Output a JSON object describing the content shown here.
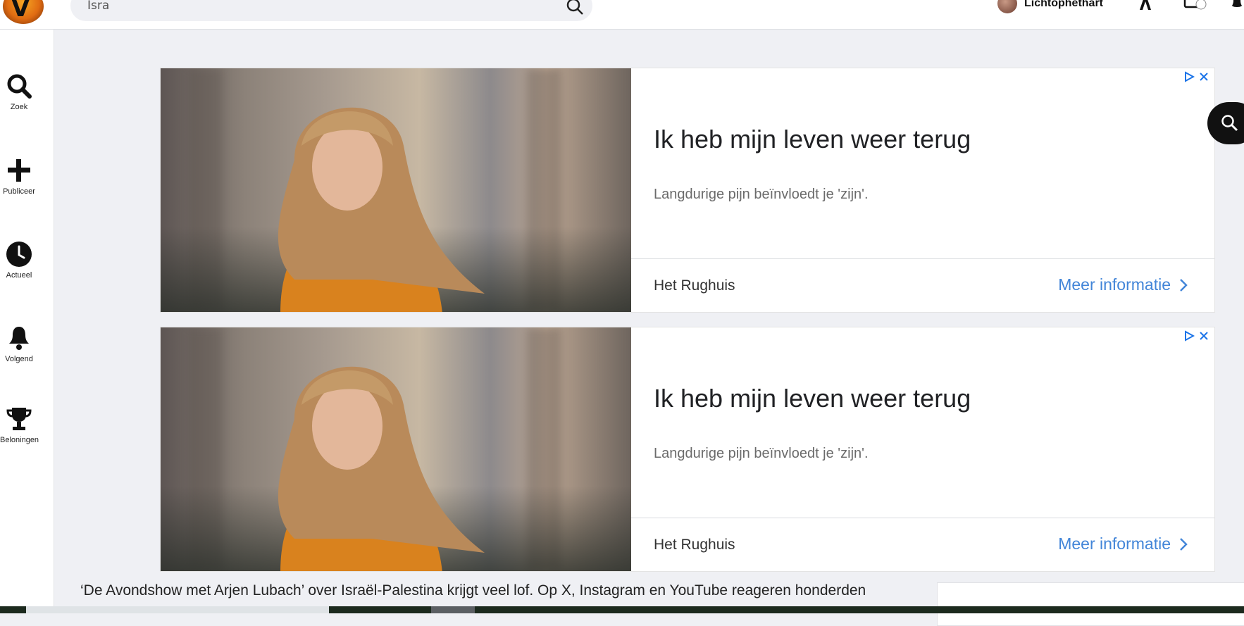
{
  "header": {
    "search_value": "Isra",
    "username": "Lichtophethart"
  },
  "sidebar": {
    "items": [
      {
        "label": "Zoek",
        "icon": "search-icon"
      },
      {
        "label": "Publiceer",
        "icon": "plus-icon"
      },
      {
        "label": "Actueel",
        "icon": "clock-icon"
      },
      {
        "label": "Volgend",
        "icon": "bell-icon"
      },
      {
        "label": "Beloningen",
        "icon": "trophy-icon"
      }
    ]
  },
  "ads": [
    {
      "headline": "Ik heb mijn leven weer terug",
      "description": "Langdurige pijn beïnvloedt je 'zijn'.",
      "advertiser": "Het Rughuis",
      "cta": "Meer informatie"
    },
    {
      "headline": "Ik heb mijn leven weer terug",
      "description": "Langdurige pijn beïnvloedt je 'zijn'.",
      "advertiser": "Het Rughuis",
      "cta": "Meer informatie"
    }
  ],
  "article": {
    "snippet": "‘De Avondshow met Arjen Lubach’ over Israël-Palestina krijgt veel lof. Op X, Instagram en YouTube reageren honderden"
  },
  "colors": {
    "cta_blue": "#4285d8",
    "background": "#eff0f4"
  }
}
